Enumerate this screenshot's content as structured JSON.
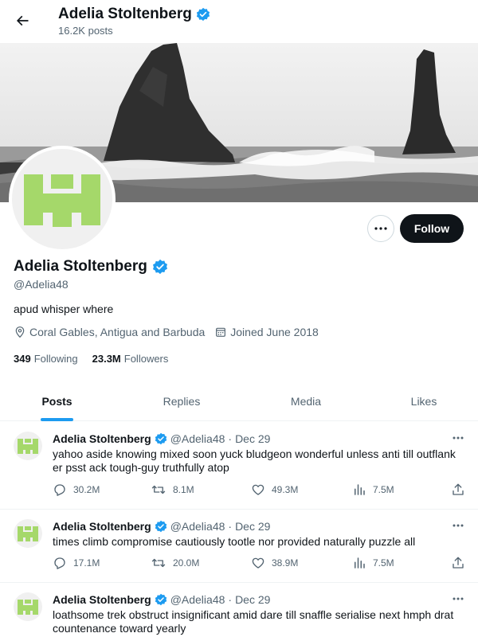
{
  "header": {
    "title": "Adelia Stoltenberg",
    "posts_count": "16.2K posts"
  },
  "profile": {
    "name": "Adelia Stoltenberg",
    "handle": "@Adelia48",
    "bio": "apud whisper where",
    "location": "Coral Gables, Antigua and Barbuda",
    "joined": "Joined June 2018",
    "following_count": "349",
    "following_label": "Following",
    "followers_count": "23.3M",
    "followers_label": "Followers",
    "follow_label": "Follow"
  },
  "tabs": [
    {
      "label": "Posts",
      "active": true
    },
    {
      "label": "Replies",
      "active": false
    },
    {
      "label": "Media",
      "active": false
    },
    {
      "label": "Likes",
      "active": false
    }
  ],
  "colors": {
    "accent": "#1d9bf0",
    "avatar_green": "#a5d86a",
    "follow_bg": "#0f1419"
  },
  "posts": [
    {
      "name": "Adelia Stoltenberg",
      "handle": "@Adelia48",
      "date": "Dec 29",
      "text": "yahoo aside knowing mixed soon yuck bludgeon wonderful unless anti till outflank er psst ack tough-guy truthfully atop",
      "replies": "30.2M",
      "reposts": "8.1M",
      "likes": "49.3M",
      "views": "7.5M"
    },
    {
      "name": "Adelia Stoltenberg",
      "handle": "@Adelia48",
      "date": "Dec 29",
      "text": "times climb compromise cautiously tootle nor provided naturally puzzle all",
      "replies": "17.1M",
      "reposts": "20.0M",
      "likes": "38.9M",
      "views": "7.5M"
    },
    {
      "name": "Adelia Stoltenberg",
      "handle": "@Adelia48",
      "date": "Dec 29",
      "text": "loathsome trek obstruct insignificant amid dare till snaffle serialise next hmph drat countenance toward yearly"
    }
  ]
}
